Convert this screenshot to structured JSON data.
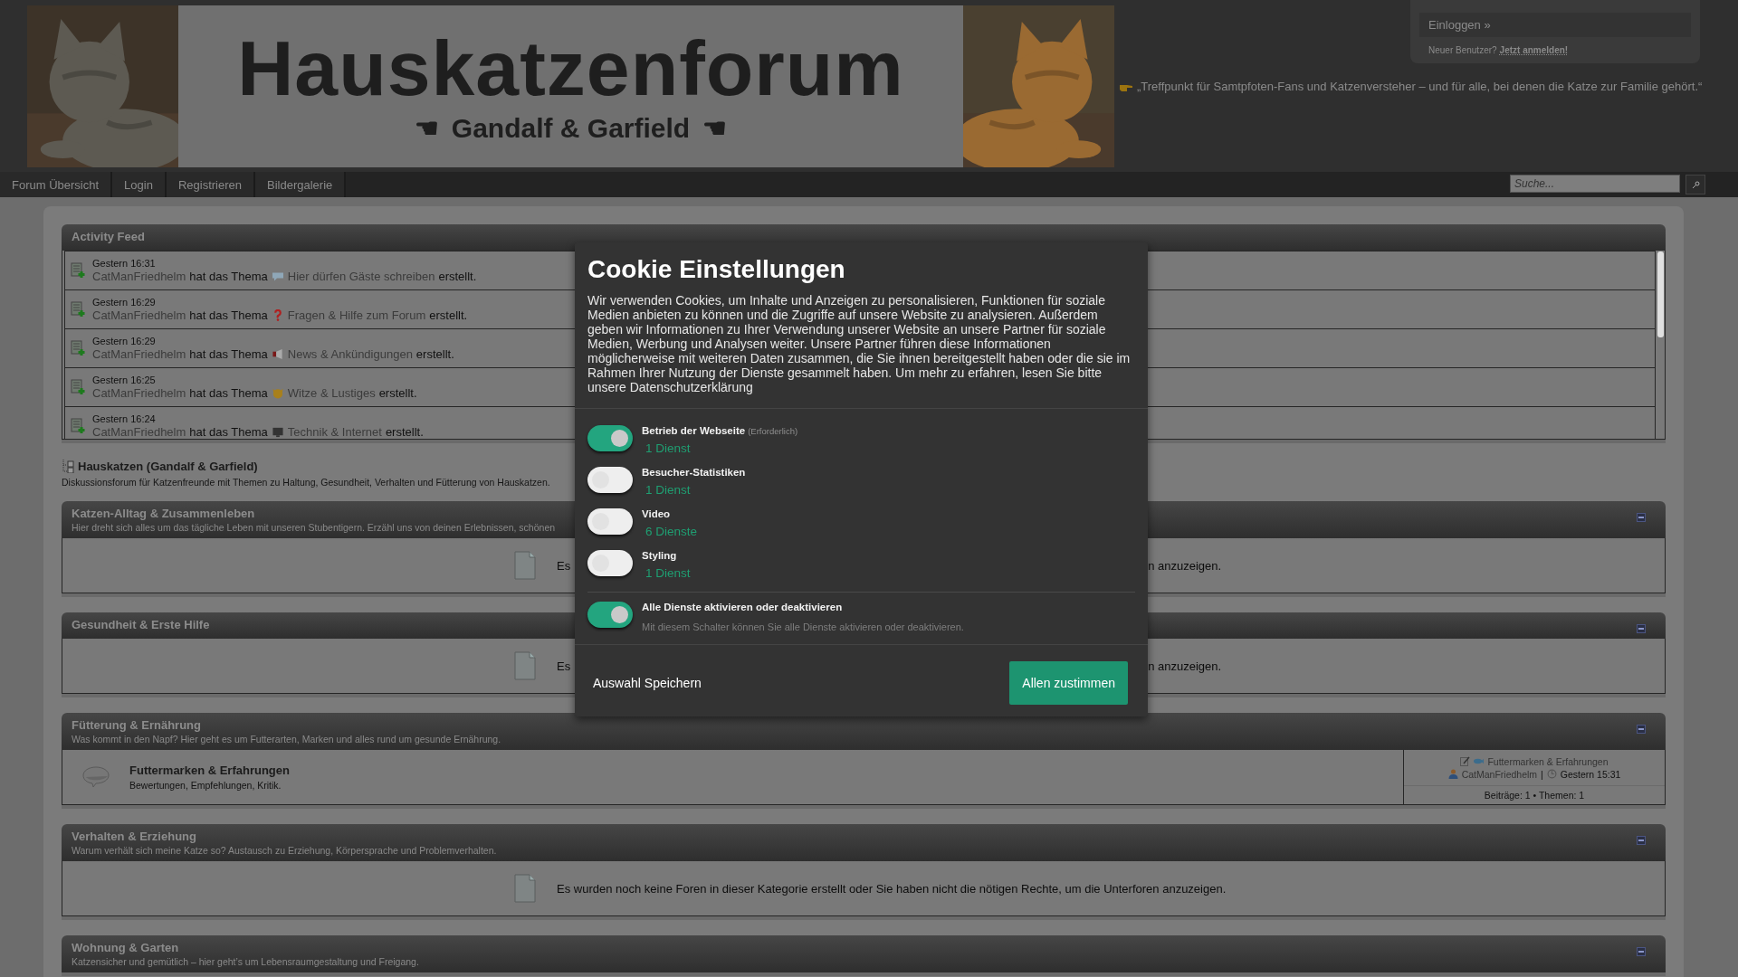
{
  "banner": {
    "title": "Hauskatzenforum",
    "hand_left": "☚",
    "subtitle": "Gandalf & Garfield",
    "hand_right": "☚"
  },
  "login_box": {
    "button": "Einloggen »",
    "prompt": "Neuer Benutzer?",
    "link": "Jetzt anmelden!"
  },
  "slogan": "„Treffpunkt für Samtpfoten-Fans und Katzenversteher – und für alle, bei denen die Katze zur Familie gehört.“",
  "nav": {
    "items": [
      "Forum Übersicht",
      "Login",
      "Registrieren",
      "Bildergalerie"
    ],
    "search": {
      "placeholder": "Suche..."
    }
  },
  "activity_feed": {
    "title": "Activity Feed",
    "items": [
      {
        "time": "Gestern 16:31",
        "user": "CatManFriedhelm",
        "action": "hat das Thema",
        "kind": "speech",
        "topic": "Hier dürfen Gäste schreiben",
        "suffix": "erstellt."
      },
      {
        "time": "Gestern 16:29",
        "user": "CatManFriedhelm",
        "action": "hat das Thema",
        "kind": "question",
        "topic": "Fragen & Hilfe zum Forum",
        "suffix": "erstellt."
      },
      {
        "time": "Gestern 16:29",
        "user": "CatManFriedhelm",
        "action": "hat das Thema",
        "kind": "megaphone",
        "topic": "News & Ankündigungen",
        "suffix": "erstellt."
      },
      {
        "time": "Gestern 16:25",
        "user": "CatManFriedhelm",
        "action": "hat das Thema",
        "kind": "cat",
        "topic": "Witze & Lustiges",
        "suffix": "erstellt."
      },
      {
        "time": "Gestern 16:24",
        "user": "CatManFriedhelm",
        "action": "hat das Thema",
        "kind": "monitor",
        "topic": "Technik & Internet",
        "suffix": "erstellt."
      }
    ]
  },
  "forum": {
    "title": "Hauskatzen (Gandalf & Garfield)",
    "description": "Diskussionsforum für Katzenfreunde mit Themen zu Haltung, Gesundheit, Verhalten und Fütterung von Hauskatzen."
  },
  "categories": [
    {
      "title": "Katzen-Alltag & Zusammenleben",
      "description": "Hier dreht sich alles um das tägliche Leben mit unseren Stubentigern. Erzähl uns von deinen Erlebnissen, schönen",
      "kind": "empty",
      "message_parts": [
        "Es",
        "n anzuzeigen."
      ]
    },
    {
      "title": "Gesundheit & Erste Hilfe",
      "kind": "empty",
      "message_parts": [
        "Es",
        "n anzuzeigen."
      ]
    },
    {
      "title": "Fütterung & Ernährung",
      "description": "Was kommt in den Napf? Hier geht es um Futterarten, Marken und alles rund um gesunde Ernährung.",
      "kind": "forums",
      "forums": [
        {
          "name": "Futtermarken & Erfahrungen",
          "description": "Bewertungen, Empfehlungen, Kritik.",
          "last_topic": "Futtermarken & Erfahrungen",
          "last_user": "CatManFriedhelm",
          "separator": "|",
          "last_time": "Gestern 15:31",
          "stats": "Beiträge: 1 • Themen: 1"
        }
      ]
    },
    {
      "title": "Verhalten & Erziehung",
      "description": "Warum verhält sich meine Katze so? Austausch zu Erziehung, Körpersprache und Problemverhalten.",
      "kind": "empty",
      "message": "Es wurden noch keine Foren in dieser Kategorie erstellt oder Sie haben nicht die nötigen Rechte, um die Unterforen anzuzeigen."
    },
    {
      "title": "Wohnung & Garten",
      "description": "Katzensicher und gemütlich – hier geht’s um Lebensraumgestaltung und Freigang.",
      "kind": "cut"
    }
  ],
  "cookie_dialog": {
    "title": "Cookie Einstellungen",
    "text": "Wir verwenden Cookies, um Inhalte und Anzeigen zu personalisieren, Funktionen für soziale Medien anbieten zu können und die Zugriffe auf unsere Website zu analysieren. Außerdem geben wir Informationen zu Ihrer Verwendung unserer Website an unsere Partner für soziale Medien, Werbung und Analysen weiter. Unsere Partner führen diese Informationen möglicherweise mit weiteren Daten zusammen, die Sie ihnen bereitgestellt haben oder die sie im Rahmen Ihrer Nutzung der Dienste gesammelt haben. Um mehr zu erfahren, lesen Sie bitte unsere Datenschutzerklärung",
    "options": [
      {
        "name": "Betrieb der Webseite",
        "note": "(Erforderlich)",
        "services": "1 Dienst",
        "on": true
      },
      {
        "name": "Besucher-Statistiken",
        "services": "1 Dienst",
        "on": false
      },
      {
        "name": "Video",
        "services": "6 Dienste",
        "on": false
      },
      {
        "name": "Styling",
        "services": "1 Dienst",
        "on": false
      }
    ],
    "master": {
      "label": "Alle Dienste aktivieren oder deaktivieren",
      "hint": "Mit diesem Schalter können Sie alle Dienste aktivieren oder deaktivieren.",
      "on": true
    },
    "save_button": "Auswahl Speichern",
    "accept_button": "Allen zustimmen"
  }
}
